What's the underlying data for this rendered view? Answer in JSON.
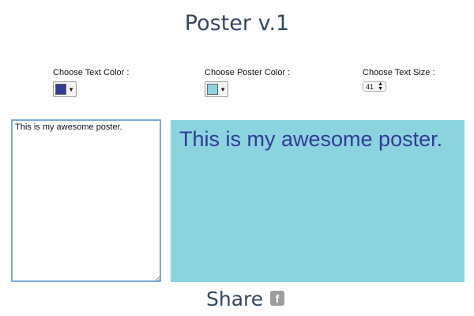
{
  "header": {
    "title": "Poster v.1"
  },
  "controls": {
    "text_color": {
      "label": "Choose Text Color :",
      "value": "#323b95",
      "arrow": "▼"
    },
    "poster_color": {
      "label": "Choose Poster Color :",
      "value": "#8cd3e0",
      "arrow": "▼"
    },
    "text_size": {
      "label": "Choose Text Size :",
      "value": "41",
      "up": "▲",
      "down": "▼"
    }
  },
  "editor": {
    "text": "This is my awesome poster."
  },
  "poster": {
    "text": "This is my awesome poster.",
    "background": "#8cd3e0",
    "text_color": "#323b95"
  },
  "share": {
    "label": "Share",
    "facebook_icon": "f"
  }
}
